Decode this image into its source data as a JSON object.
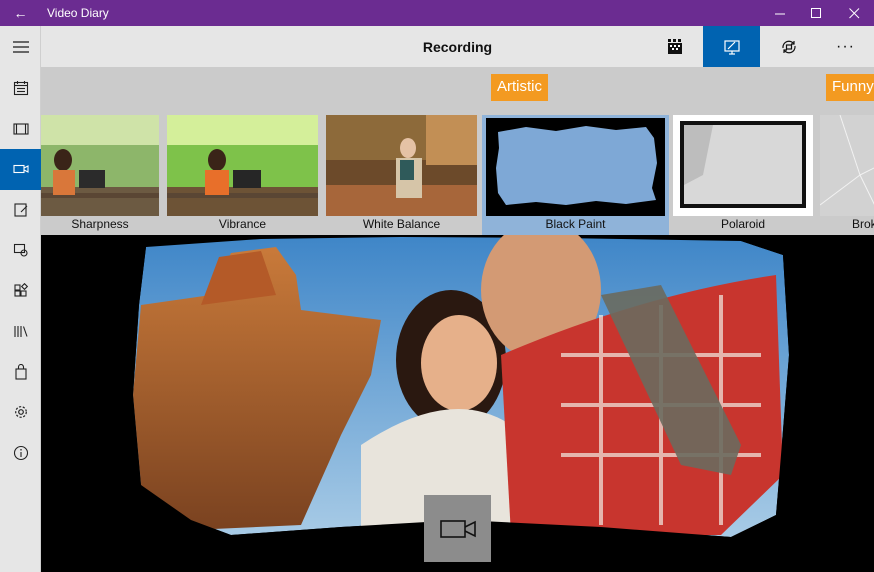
{
  "window": {
    "title": "Video Diary",
    "back_icon": "←",
    "minimize": "—",
    "maximize": "☐",
    "close": "✕"
  },
  "header": {
    "title": "Recording",
    "more": "···"
  },
  "sidebar": {
    "items": [
      {
        "name": "hamburger-menu-icon",
        "active": false
      },
      {
        "name": "calendar-icon",
        "active": false
      },
      {
        "name": "filmstrip-icon",
        "active": false
      },
      {
        "name": "video-camera-icon",
        "active": true
      },
      {
        "name": "edit-note-icon",
        "active": false
      },
      {
        "name": "tags-icon",
        "active": false
      },
      {
        "name": "apps-icon",
        "active": false
      },
      {
        "name": "library-icon",
        "active": false
      },
      {
        "name": "shopping-bag-icon",
        "active": false
      },
      {
        "name": "settings-icon",
        "active": false
      },
      {
        "name": "info-icon",
        "active": false
      }
    ]
  },
  "filters": {
    "categories": [
      "Artistic",
      "Funny"
    ],
    "thumbnails": [
      {
        "label": "Sharpness",
        "selected": false
      },
      {
        "label": "Vibrance",
        "selected": false
      },
      {
        "label": "White Balance",
        "selected": false
      },
      {
        "label": "Black Paint",
        "selected": true
      },
      {
        "label": "Polaroid",
        "selected": false
      },
      {
        "label": "Brok",
        "selected": false
      }
    ]
  },
  "colors": {
    "title_bar": "#6b2c91",
    "accent": "#0063b1",
    "category": "#f39a21",
    "selected_thumb": "#8fb3d9"
  }
}
